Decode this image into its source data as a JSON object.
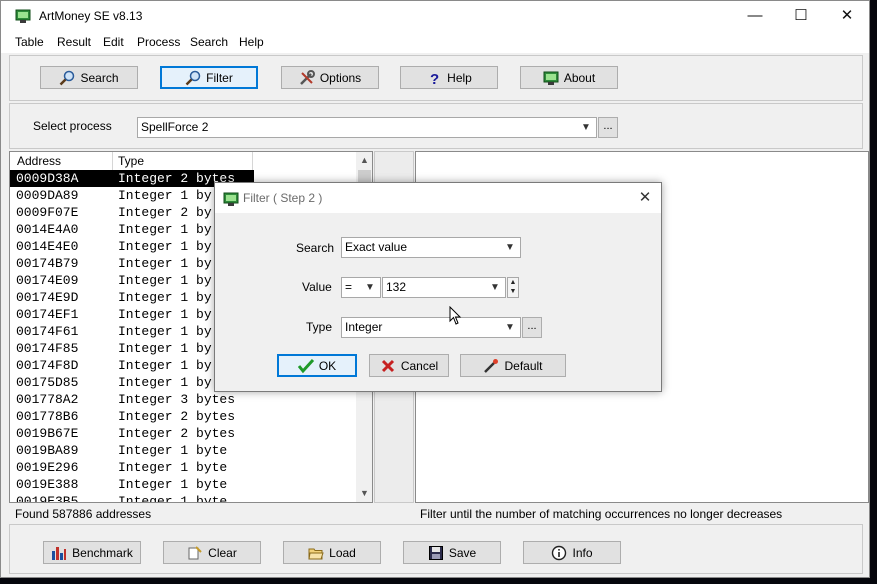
{
  "window": {
    "title": "ArtMoney SE v8.13",
    "controls": {
      "minimize": "—",
      "maximize": "☐",
      "close": "✕"
    }
  },
  "menu": [
    "Table",
    "Result",
    "Edit",
    "Process",
    "Search",
    "Help"
  ],
  "toolbar": {
    "search": "Search",
    "filter": "Filter",
    "options": "Options",
    "help": "Help",
    "about": "About"
  },
  "process": {
    "label": "Select process",
    "selected": "SpellForce 2",
    "browse": "..."
  },
  "table": {
    "columns": [
      "Address",
      "Type"
    ],
    "rows": [
      {
        "address": "0009D38A",
        "type": "Integer 2 bytes"
      },
      {
        "address": "0009DA89",
        "type": "Integer 1 by"
      },
      {
        "address": "0009F07E",
        "type": "Integer 2 by"
      },
      {
        "address": "0014E4A0",
        "type": "Integer 1 by"
      },
      {
        "address": "0014E4E0",
        "type": "Integer 1 by"
      },
      {
        "address": "00174B79",
        "type": "Integer 1 by"
      },
      {
        "address": "00174E09",
        "type": "Integer 1 by"
      },
      {
        "address": "00174E9D",
        "type": "Integer 1 by"
      },
      {
        "address": "00174EF1",
        "type": "Integer 1 by"
      },
      {
        "address": "00174F61",
        "type": "Integer 1 by"
      },
      {
        "address": "00174F85",
        "type": "Integer 1 by"
      },
      {
        "address": "00174F8D",
        "type": "Integer 1 by"
      },
      {
        "address": "00175D85",
        "type": "Integer 1 by"
      },
      {
        "address": "001778A2",
        "type": "Integer 3 bytes"
      },
      {
        "address": "001778B6",
        "type": "Integer 2 bytes"
      },
      {
        "address": "0019B67E",
        "type": "Integer 2 bytes"
      },
      {
        "address": "0019BA89",
        "type": "Integer 1 byte"
      },
      {
        "address": "0019E296",
        "type": "Integer 1 byte"
      },
      {
        "address": "0019E388",
        "type": "Integer 1 byte"
      },
      {
        "address": "0019E3B5",
        "type": "Integer 1 byte"
      }
    ]
  },
  "status": {
    "left": "Found 587886 addresses",
    "right": "Filter until the number of matching occurrences no longer decreases"
  },
  "bottom": {
    "benchmark": "Benchmark",
    "clear": "Clear",
    "load": "Load",
    "save": "Save",
    "info": "Info"
  },
  "dialog": {
    "title": "Filter ( Step 2 )",
    "search_label": "Search",
    "search_value": "Exact value",
    "value_label": "Value",
    "operator": "=",
    "value": "132",
    "type_label": "Type",
    "type_value": "Integer",
    "type_browse": "...",
    "ok": "OK",
    "cancel": "Cancel",
    "default": "Default"
  },
  "colors": {
    "accent": "#0078d7",
    "selected_row_bg": "#000000",
    "window_bg": "#f0f0f0"
  }
}
